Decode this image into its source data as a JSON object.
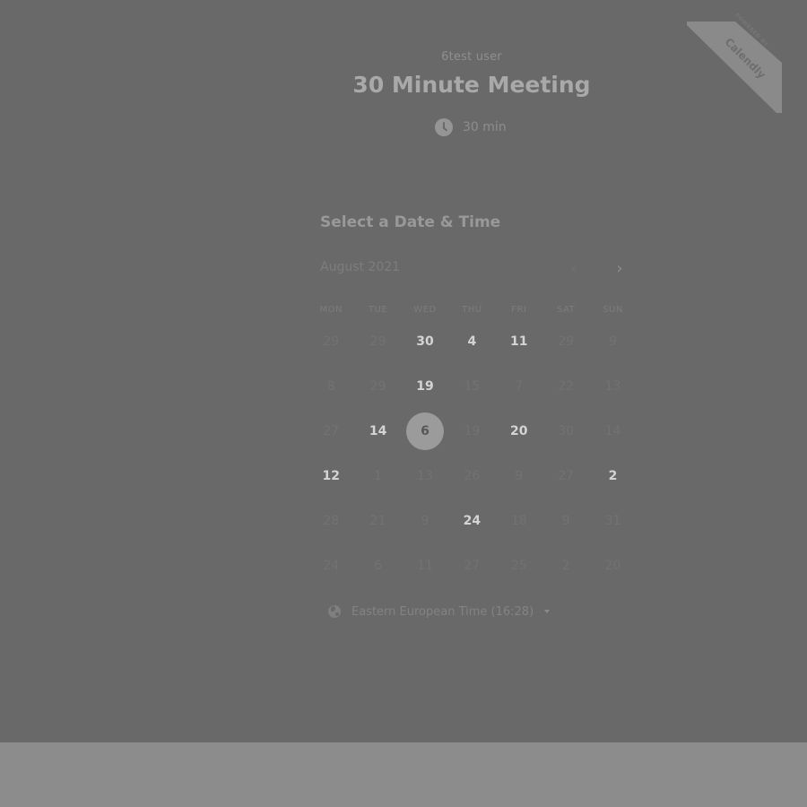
{
  "header": {
    "owner": "6test user",
    "title": "30 Minute Meeting",
    "duration": "30 min"
  },
  "badge": {
    "small": "POWERED BY",
    "brand": "Calendly"
  },
  "calendar": {
    "heading": "Select a Date & Time",
    "month": "August 2021",
    "prev_label": "‹",
    "next_label": "›",
    "weekdays": [
      "MON",
      "TUE",
      "WED",
      "THU",
      "FRI",
      "SAT",
      "SUN"
    ],
    "rows": [
      [
        {
          "d": "29",
          "a": false
        },
        {
          "d": "29",
          "a": false
        },
        {
          "d": "30",
          "a": true
        },
        {
          "d": "4",
          "a": true
        },
        {
          "d": "11",
          "a": true
        },
        {
          "d": "29",
          "a": false
        },
        {
          "d": "9",
          "a": false
        }
      ],
      [
        {
          "d": "8",
          "a": false
        },
        {
          "d": "29",
          "a": false
        },
        {
          "d": "19",
          "a": true
        },
        {
          "d": "15",
          "a": false
        },
        {
          "d": "7",
          "a": false
        },
        {
          "d": "22",
          "a": false
        },
        {
          "d": "13",
          "a": false
        }
      ],
      [
        {
          "d": "27",
          "a": false
        },
        {
          "d": "14",
          "a": true
        },
        {
          "d": "6",
          "a": true,
          "s": true
        },
        {
          "d": "19",
          "a": false
        },
        {
          "d": "20",
          "a": true
        },
        {
          "d": "30",
          "a": false
        },
        {
          "d": "14",
          "a": false
        }
      ],
      [
        {
          "d": "12",
          "a": true
        },
        {
          "d": "1",
          "a": false
        },
        {
          "d": "13",
          "a": false
        },
        {
          "d": "26",
          "a": false
        },
        {
          "d": "9",
          "a": false
        },
        {
          "d": "27",
          "a": false
        },
        {
          "d": "2",
          "a": true
        }
      ],
      [
        {
          "d": "28",
          "a": false
        },
        {
          "d": "21",
          "a": false
        },
        {
          "d": "9",
          "a": false
        },
        {
          "d": "24",
          "a": true
        },
        {
          "d": "18",
          "a": false
        },
        {
          "d": "9",
          "a": false
        },
        {
          "d": "31",
          "a": false
        }
      ],
      [
        {
          "d": "24",
          "a": false
        },
        {
          "d": "6",
          "a": false
        },
        {
          "d": "11",
          "a": false
        },
        {
          "d": "27",
          "a": false
        },
        {
          "d": "25",
          "a": false
        },
        {
          "d": "2",
          "a": false
        },
        {
          "d": "20",
          "a": false
        }
      ]
    ]
  },
  "timezone": {
    "label": "Eastern European Time (16:28)"
  },
  "colors": {
    "panel": "#696969",
    "footer": "#8c8c8c",
    "selected_circle": "#9b9b9b"
  }
}
